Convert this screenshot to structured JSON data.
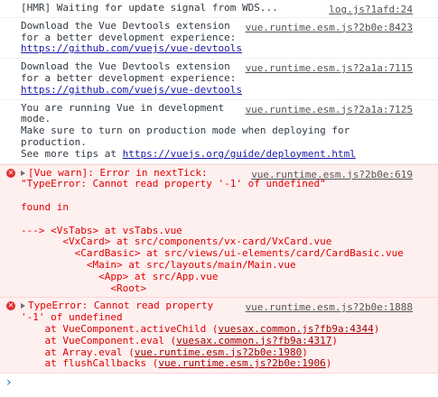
{
  "messages": {
    "hmr": {
      "text": "[HMR] Waiting for update signal from WDS...",
      "source": "log.js?1afd:24"
    },
    "devtools1": {
      "line1": "Download the Vue Devtools extension",
      "line2": "for a better development experience:",
      "url": "https://github.com/vuejs/vue-devtools",
      "source": "vue.runtime.esm.js?2b0e:8423"
    },
    "devtools2": {
      "line1": "Download the Vue Devtools extension",
      "line2": "for a better development experience:",
      "url": "https://github.com/vuejs/vue-devtools",
      "source": "vue.runtime.esm.js?2a1a:7115"
    },
    "devmode": {
      "line1": "You are running Vue in development",
      "line2": "mode.",
      "line3": "Make sure to turn on production mode when deploying for",
      "line4": "production.",
      "line5_prefix": "See more tips at ",
      "url": "https://vuejs.org/guide/deployment.html",
      "source": "vue.runtime.esm.js?2a1a:7125"
    },
    "warn": {
      "line1": "[Vue warn]: Error in nextTick:",
      "line2": "\"TypeError: Cannot read property '-1' of undefined\"",
      "found": "found in",
      "trace1": "---> <VsTabs> at vsTabs.vue",
      "trace2": "       <VxCard> at src/components/vx-card/VxCard.vue",
      "trace3": "         <CardBasic> at src/views/ui-elements/card/CardBasic.vue",
      "trace4": "           <Main> at src/layouts/main/Main.vue",
      "trace5": "             <App> at src/App.vue",
      "trace6": "               <Root>",
      "source": "vue.runtime.esm.js?2b0e:619"
    },
    "typeerror": {
      "line1": "TypeError: Cannot read property",
      "line2": "'-1' of undefined",
      "stack": [
        {
          "prefix": "    at VueComponent.activeChild (",
          "link": "vuesax.common.js?fb9a:4344",
          "suffix": ")"
        },
        {
          "prefix": "    at VueComponent.eval (",
          "link": "vuesax.common.js?fb9a:4317",
          "suffix": ")"
        },
        {
          "prefix": "    at Array.eval (",
          "link": "vue.runtime.esm.js?2b0e:1980",
          "suffix": ")"
        },
        {
          "prefix": "    at flushCallbacks (",
          "link": "vue.runtime.esm.js?2b0e:1906",
          "suffix": ")"
        }
      ],
      "source": "vue.runtime.esm.js?2b0e:1888"
    }
  },
  "prompt_symbol": "›",
  "error_symbol": "✕"
}
